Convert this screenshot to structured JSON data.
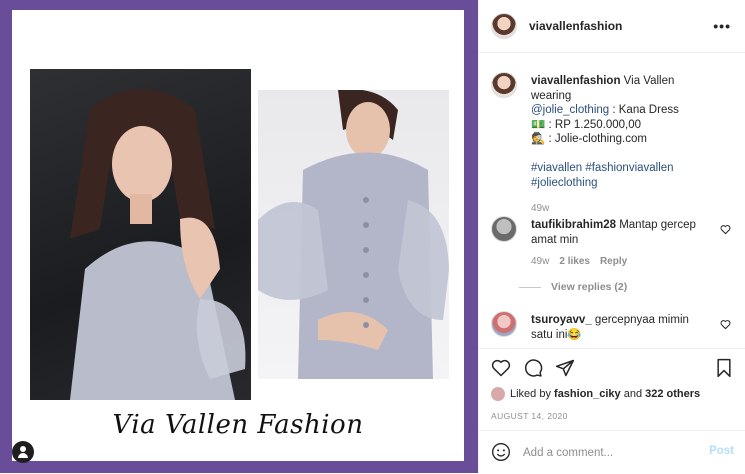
{
  "post": {
    "brand_text": "Via Vallen Fashion"
  },
  "header": {
    "username": "viavallenfashion",
    "more_label": "•••"
  },
  "caption": {
    "username": "viavallenfashion",
    "text1": " Via Vallen wearing ",
    "mention": "@jolie_clothing",
    "text2": " : Kana Dress",
    "price_line": "💵 : RP 1.250.000,00",
    "web_line": "🕵 : Jolie-clothing.com",
    "hashtags_line1": "#viavallen #fashionviavallen",
    "hashtags_line2": "#jolieclothing",
    "time": "49w"
  },
  "comments": [
    {
      "username": "taufikibrahim28",
      "text": " Mantap gercep amat min",
      "time": "49w",
      "likes": "2 likes",
      "reply": "Reply",
      "view_replies": "View replies (2)"
    },
    {
      "username": "tsuroyavv_",
      "text": " gercepnyaa mimin satu ini😂"
    }
  ],
  "actions": {
    "liked_by_prefix": "Liked by ",
    "liked_by_user": "fashion_ciky",
    "liked_by_and": " and ",
    "liked_by_others": "322 others",
    "date": "AUGUST 14, 2020"
  },
  "add_comment": {
    "placeholder": "Add a comment...",
    "post_label": "Post"
  },
  "colors": {
    "frame": "#6a4d99",
    "link": "#2b4f7e",
    "post_button": "#b2dffc"
  }
}
